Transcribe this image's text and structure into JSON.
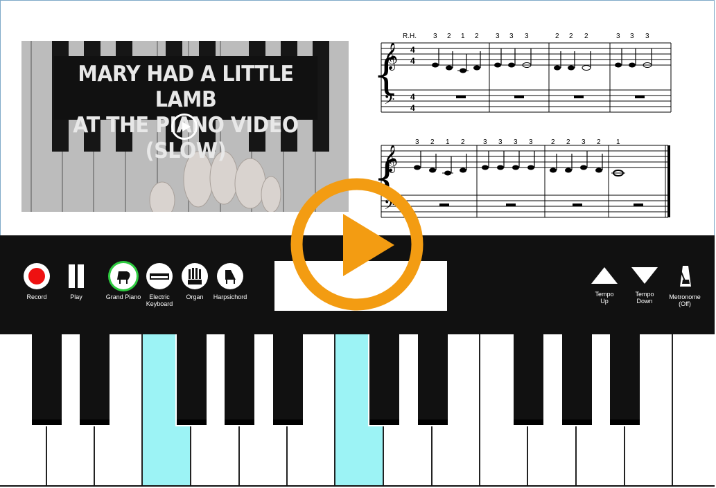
{
  "video": {
    "title_line1": "MARY HAD A LITTLE LAMB",
    "title_line2": "AT THE PIANO VIDEO (SLOW)"
  },
  "sheet": {
    "hand_label": "R.H.",
    "time_signature": "4/4",
    "line1_fingerings": [
      "3",
      "2",
      "1",
      "2",
      "3",
      "3",
      "3",
      "2",
      "2",
      "2",
      "3",
      "3",
      "3"
    ],
    "line2_fingerings": [
      "3",
      "2",
      "1",
      "2",
      "3",
      "3",
      "3",
      "3",
      "2",
      "2",
      "3",
      "2",
      "1"
    ]
  },
  "controls": {
    "record_label": "Record",
    "play_label": "Play",
    "instruments": [
      {
        "label": "Grand Piano",
        "icon": "grand-piano-icon",
        "selected": true
      },
      {
        "label": "Electric Keyboard",
        "icon": "electric-keyboard-icon",
        "selected": false
      },
      {
        "label": "Organ",
        "icon": "organ-icon",
        "selected": false
      },
      {
        "label": "Harpsichord",
        "icon": "harpsichord-icon",
        "selected": false
      }
    ],
    "display_text": "",
    "tempo_up_label": "Tempo Up",
    "tempo_down_label": "Tempo Down",
    "metronome_label": "Metronome (Off)"
  },
  "colors": {
    "accent_play": "#f39c12",
    "record_red": "#e11111",
    "selected_ring": "#2ecc40",
    "highlight_key": "#9cf3f5"
  }
}
